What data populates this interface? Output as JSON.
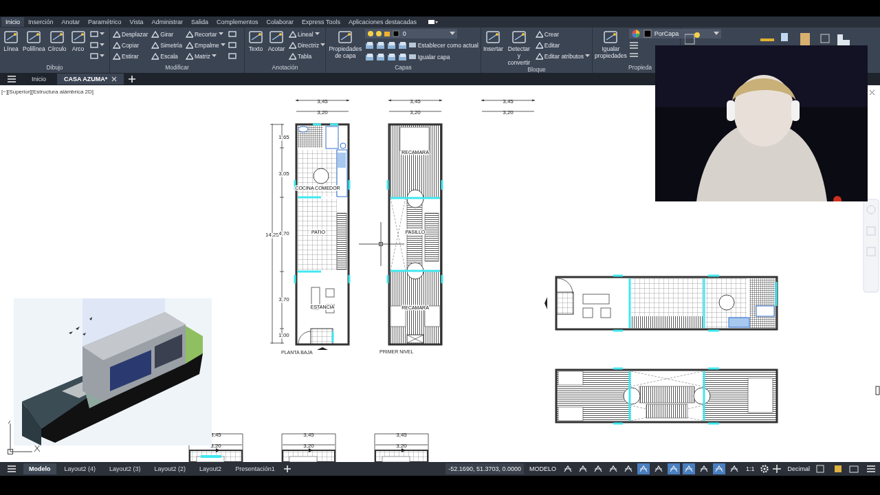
{
  "menu_tabs": [
    {
      "label": "Inicio",
      "selected": true
    },
    {
      "label": "Inserción",
      "selected": false
    },
    {
      "label": "Anotar",
      "selected": false
    },
    {
      "label": "Paramétrico",
      "selected": false
    },
    {
      "label": "Vista",
      "selected": false
    },
    {
      "label": "Administrar",
      "selected": false
    },
    {
      "label": "Salida",
      "selected": false
    },
    {
      "label": "Complementos",
      "selected": false
    },
    {
      "label": "Colaborar",
      "selected": false
    },
    {
      "label": "Express Tools",
      "selected": false
    },
    {
      "label": "Aplicaciones destacadas",
      "selected": false
    }
  ],
  "ribbon_panels": [
    {
      "title": "Dibujo",
      "large": [
        "Línea",
        "Polilínea",
        "Círculo",
        "Arco"
      ],
      "columns": [
        [
          {
            "kind": "icon",
            "menu": true
          },
          {
            "kind": "icon",
            "menu": true
          },
          {
            "kind": "icon",
            "menu": true
          }
        ]
      ]
    },
    {
      "title": "Modificar",
      "columns": [
        [
          {
            "kind": "tool",
            "label": "Desplazar",
            "menu": false
          },
          {
            "kind": "tool",
            "label": "Copiar",
            "menu": false
          },
          {
            "kind": "tool",
            "label": "Estirar",
            "menu": false
          }
        ],
        [
          {
            "kind": "tool",
            "label": "Girar",
            "menu": false
          },
          {
            "kind": "tool",
            "label": "Simetría",
            "menu": false
          },
          {
            "kind": "tool",
            "label": "Escala",
            "menu": false
          }
        ],
        [
          {
            "kind": "tool",
            "label": "Recortar",
            "menu": true
          },
          {
            "kind": "tool",
            "label": "Empalme",
            "menu": true
          },
          {
            "kind": "tool",
            "label": "Matriz",
            "menu": true
          }
        ],
        [
          {
            "kind": "icon",
            "menu": false
          },
          {
            "kind": "icon",
            "menu": false
          },
          {
            "kind": "icon",
            "menu": false
          }
        ]
      ]
    },
    {
      "title": "Anotación",
      "large": [
        "Texto",
        "Acotar"
      ],
      "columns": [
        [
          {
            "kind": "tool",
            "label": "Lineal",
            "menu": true
          },
          {
            "kind": "tool",
            "label": "Directriz",
            "menu": true
          },
          {
            "kind": "tool",
            "label": "Tabla",
            "menu": false
          }
        ]
      ]
    },
    {
      "title": "Capas",
      "large": [
        "Propiedades de capa"
      ],
      "layer": {
        "value": "0"
      },
      "columns": [
        [
          {
            "kind": "tool",
            "label": "Establecer como actual",
            "menu": false
          },
          {
            "kind": "tool",
            "label": "Igualar capa",
            "menu": false
          }
        ]
      ]
    },
    {
      "title": "Bloque",
      "large": [
        "Insertar",
        "Detectar y convertir"
      ],
      "columns": [
        [
          {
            "kind": "tool",
            "label": "Crear",
            "menu": false
          },
          {
            "kind": "tool",
            "label": "Editar",
            "menu": false
          },
          {
            "kind": "tool",
            "label": "Editar atributos",
            "menu": true
          }
        ]
      ]
    },
    {
      "title": "Propieda",
      "large": [
        "Igualar propiedades"
      ],
      "property": {
        "value": "PorCapa"
      }
    }
  ],
  "file_tabs": [
    {
      "label": "Inicio",
      "selected": false
    },
    {
      "label": "CASA AZUMA*",
      "selected": true
    }
  ],
  "drawing": {
    "viewport_label": "[−][Superior][Estructura alámbrica 2D]",
    "top_dimensions": [
      {
        "overall": "3,45",
        "inner": "3,20"
      },
      {
        "overall": "3,45",
        "inner": "3,20"
      },
      {
        "overall": "3,45",
        "inner": "3,20"
      }
    ],
    "side_dimensions": {
      "total": "14,25",
      "parts": [
        "1,65",
        "3,05",
        "4,70",
        "3,70",
        "1,00"
      ]
    },
    "plans": [
      {
        "kind": "ground",
        "title": "PLANTA BAJA",
        "rooms": [
          "COCINA COMEDOR",
          "PATIO",
          "ESTANCIA"
        ]
      },
      {
        "kind": "upper",
        "title": "PRIMER NIVEL",
        "rooms": [
          "RECAMARA",
          "PASILLO",
          "RECAMARA"
        ]
      },
      {
        "kind": "ground-rotated"
      },
      {
        "kind": "upper-rotated"
      }
    ],
    "bottom_dimensions": [
      {
        "overall": "3,45",
        "inner": "3,20"
      },
      {
        "overall": "3,45",
        "inner": "3,20"
      },
      {
        "overall": "3,45",
        "inner": "3,20"
      }
    ]
  },
  "layout_tabs": [
    {
      "label": "Modelo",
      "selected": true
    },
    {
      "label": "Layout2 (4)",
      "selected": false
    },
    {
      "label": "Layout2 (3)",
      "selected": false
    },
    {
      "label": "Layout2 (2)",
      "selected": false
    },
    {
      "label": "Layout2",
      "selected": false
    },
    {
      "label": "Presentación1",
      "selected": false
    }
  ],
  "status_bar": {
    "coordinates": "-52.1690, 51.3703, 0.0000",
    "space": "MODELO",
    "toggles": [
      {
        "on": false
      },
      {
        "on": false
      },
      {
        "on": false
      },
      {
        "on": false
      },
      {
        "on": false
      },
      {
        "on": true
      },
      {
        "on": false
      },
      {
        "on": true
      },
      {
        "on": true
      },
      {
        "on": false
      },
      {
        "on": true
      },
      {
        "on": false
      }
    ],
    "scale": "1:1",
    "units": "Decimal"
  }
}
